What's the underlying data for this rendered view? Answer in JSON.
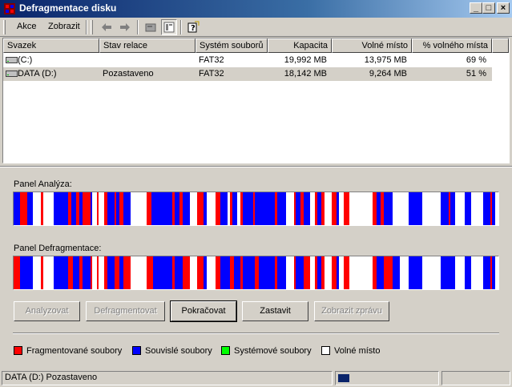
{
  "window": {
    "title": "Defragmentace disku"
  },
  "menu": [
    {
      "label": "Akce"
    },
    {
      "label": "Zobrazit"
    }
  ],
  "toolbar": {
    "buttons": [
      "back-icon",
      "forward-icon",
      "drive-properties-icon",
      "view-report-icon",
      "help-icon"
    ]
  },
  "volumes": {
    "columns": [
      "Svazek",
      "Stav relace",
      "Systém souborů",
      "Kapacita",
      "Volné místo",
      "% volného místa"
    ],
    "rows": [
      {
        "volume": "(C:)",
        "status": "",
        "fs": "FAT32",
        "capacity": "19,992 MB",
        "free": "13,975 MB",
        "pct_free": "69 %"
      },
      {
        "volume": "DATA (D:)",
        "status": "Pozastaveno",
        "fs": "FAT32",
        "capacity": "18,142 MB",
        "free": "9,264 MB",
        "pct_free": "51 %"
      }
    ]
  },
  "analysis_panel": {
    "label": "Panel Analýza:"
  },
  "defrag_panel": {
    "label": "Panel Defragmentace:"
  },
  "map_data": {
    "colors": {
      "fragmented": "#ff0000",
      "contiguous": "#0000ff",
      "system": "#00ff00",
      "free": "#ffffff"
    },
    "analysis": [
      [
        "c",
        0,
        0.014
      ],
      [
        "f",
        0.014,
        0.028
      ],
      [
        "c",
        0.028,
        0.039
      ],
      [
        "f",
        0.057,
        0.061
      ],
      [
        "c",
        0.083,
        0.112
      ],
      [
        "f",
        0.112,
        0.119
      ],
      [
        "c",
        0.119,
        0.129
      ],
      [
        "f",
        0.129,
        0.135
      ],
      [
        "c",
        0.135,
        0.142
      ],
      [
        "f",
        0.142,
        0.158
      ],
      [
        "c",
        0.158,
        0.162
      ],
      [
        "f",
        0.172,
        0.176
      ],
      [
        "f",
        0.187,
        0.194
      ],
      [
        "c",
        0.194,
        0.209
      ],
      [
        "f",
        0.209,
        0.212
      ],
      [
        "c",
        0.212,
        0.219
      ],
      [
        "f",
        0.219,
        0.227
      ],
      [
        "c",
        0.227,
        0.242
      ],
      [
        "f",
        0.275,
        0.284
      ],
      [
        "c",
        0.284,
        0.328
      ],
      [
        "f",
        0.328,
        0.332
      ],
      [
        "c",
        0.332,
        0.342
      ],
      [
        "f",
        0.342,
        0.349
      ],
      [
        "c",
        0.349,
        0.363
      ],
      [
        "f",
        0.378,
        0.392
      ],
      [
        "c",
        0.392,
        0.399
      ],
      [
        "f",
        0.417,
        0.426
      ],
      [
        "c",
        0.426,
        0.442
      ],
      [
        "f",
        0.447,
        0.451
      ],
      [
        "c",
        0.451,
        0.461
      ],
      [
        "f",
        0.467,
        0.473
      ],
      [
        "c",
        0.473,
        0.494
      ],
      [
        "f",
        0.494,
        0.498
      ],
      [
        "c",
        0.498,
        0.539
      ],
      [
        "f",
        0.539,
        0.543
      ],
      [
        "c",
        0.543,
        0.562
      ],
      [
        "f",
        0.578,
        0.582
      ],
      [
        "c",
        0.582,
        0.592
      ],
      [
        "f",
        0.592,
        0.598
      ],
      [
        "c",
        0.598,
        0.611
      ],
      [
        "f",
        0.621,
        0.627
      ],
      [
        "c",
        0.627,
        0.634
      ],
      [
        "f",
        0.634,
        0.641
      ],
      [
        "f",
        0.656,
        0.666
      ],
      [
        "c",
        0.666,
        0.671
      ],
      [
        "f",
        0.681,
        0.693
      ],
      [
        "f",
        0.741,
        0.748
      ],
      [
        "c",
        0.748,
        0.757
      ],
      [
        "f",
        0.757,
        0.763
      ],
      [
        "c",
        0.763,
        0.781
      ],
      [
        "c",
        0.815,
        0.843
      ],
      [
        "c",
        0.881,
        0.898
      ],
      [
        "f",
        0.898,
        0.901
      ],
      [
        "c",
        0.901,
        0.911
      ],
      [
        "c",
        0.931,
        0.944
      ],
      [
        "c",
        0.968,
        0.983
      ],
      [
        "f",
        0.983,
        0.987
      ],
      [
        "c",
        0.987,
        0.993
      ]
    ],
    "defrag": [
      [
        "f",
        0,
        0.014
      ],
      [
        "c",
        0.014,
        0.039
      ],
      [
        "f",
        0.057,
        0.061
      ],
      [
        "c",
        0.083,
        0.112
      ],
      [
        "f",
        0.112,
        0.122
      ],
      [
        "c",
        0.122,
        0.135
      ],
      [
        "f",
        0.135,
        0.142
      ],
      [
        "c",
        0.142,
        0.158
      ],
      [
        "f",
        0.158,
        0.162
      ],
      [
        "f",
        0.172,
        0.176
      ],
      [
        "f",
        0.187,
        0.194
      ],
      [
        "c",
        0.194,
        0.209
      ],
      [
        "f",
        0.209,
        0.219
      ],
      [
        "c",
        0.219,
        0.227
      ],
      [
        "f",
        0.227,
        0.242
      ],
      [
        "f",
        0.275,
        0.287
      ],
      [
        "c",
        0.287,
        0.328
      ],
      [
        "f",
        0.328,
        0.332
      ],
      [
        "c",
        0.332,
        0.349
      ],
      [
        "f",
        0.349,
        0.363
      ],
      [
        "f",
        0.378,
        0.392
      ],
      [
        "c",
        0.392,
        0.399
      ],
      [
        "f",
        0.417,
        0.426
      ],
      [
        "c",
        0.426,
        0.447
      ],
      [
        "f",
        0.447,
        0.455
      ],
      [
        "c",
        0.455,
        0.467
      ],
      [
        "f",
        0.467,
        0.473
      ],
      [
        "c",
        0.473,
        0.498
      ],
      [
        "f",
        0.498,
        0.505
      ],
      [
        "c",
        0.505,
        0.539
      ],
      [
        "f",
        0.539,
        0.543
      ],
      [
        "c",
        0.543,
        0.562
      ],
      [
        "f",
        0.578,
        0.582
      ],
      [
        "c",
        0.582,
        0.598
      ],
      [
        "f",
        0.598,
        0.611
      ],
      [
        "f",
        0.621,
        0.627
      ],
      [
        "c",
        0.627,
        0.634
      ],
      [
        "f",
        0.634,
        0.641
      ],
      [
        "f",
        0.656,
        0.666
      ],
      [
        "c",
        0.666,
        0.671
      ],
      [
        "f",
        0.681,
        0.693
      ],
      [
        "f",
        0.741,
        0.748
      ],
      [
        "c",
        0.748,
        0.763
      ],
      [
        "f",
        0.763,
        0.781
      ],
      [
        "c",
        0.781,
        0.797
      ],
      [
        "c",
        0.815,
        0.843
      ],
      [
        "c",
        0.881,
        0.901
      ],
      [
        "c",
        0.901,
        0.911
      ],
      [
        "c",
        0.931,
        0.944
      ],
      [
        "c",
        0.968,
        0.983
      ],
      [
        "f",
        0.983,
        0.987
      ],
      [
        "c",
        0.987,
        0.993
      ]
    ]
  },
  "buttons": [
    {
      "label": "Analyzovat",
      "enabled": false
    },
    {
      "label": "Defragmentovat",
      "enabled": false
    },
    {
      "label": "Pokračovat",
      "enabled": true
    },
    {
      "label": "Zastavit",
      "enabled": true
    },
    {
      "label": "Zobrazit zprávu",
      "enabled": false
    }
  ],
  "legend": [
    {
      "label": "Fragmentované soubory",
      "color": "#ff0000"
    },
    {
      "label": "Souvislé soubory",
      "color": "#0000ff"
    },
    {
      "label": "Systémové soubory",
      "color": "#00ff00"
    },
    {
      "label": "Volné místo",
      "color": "#ffffff"
    }
  ],
  "status_bar": {
    "text": "DATA (D:) Pozastaveno",
    "progress": 0.11
  }
}
